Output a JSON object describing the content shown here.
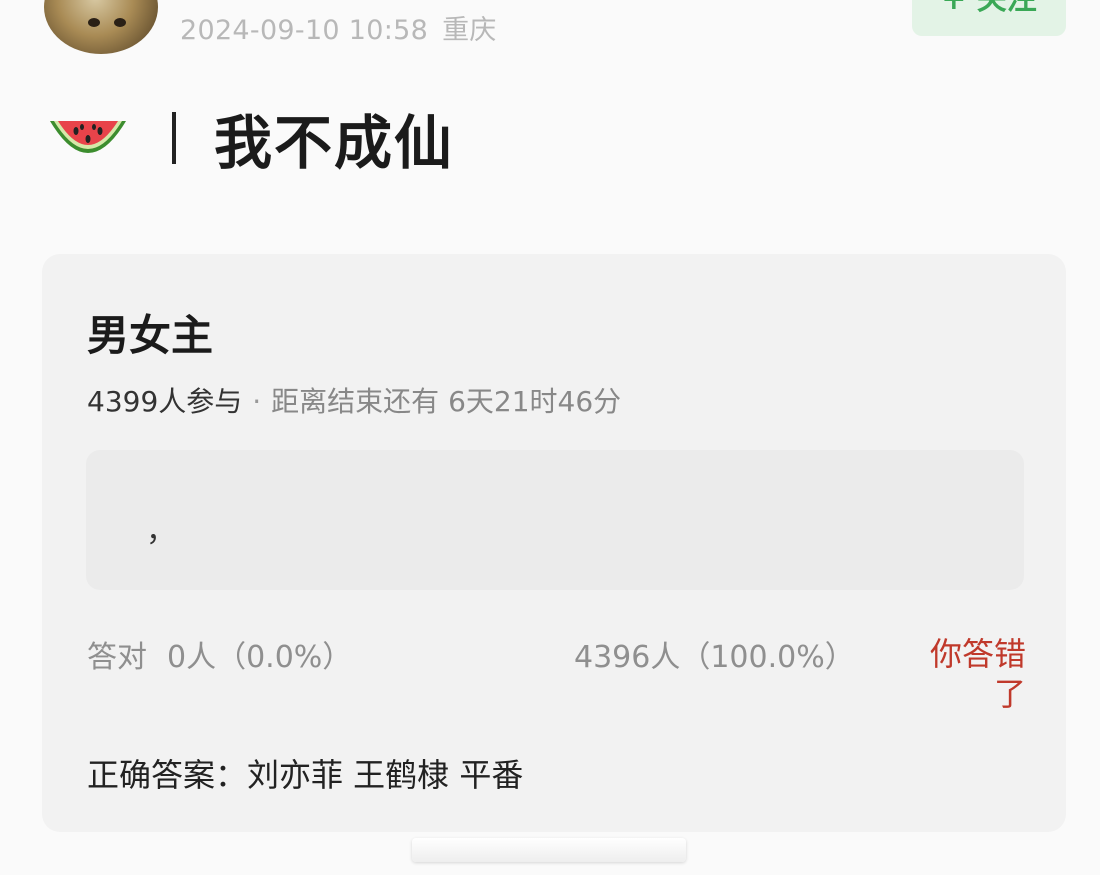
{
  "header": {
    "timestamp": "2024-09-10 10:58",
    "location": "重庆",
    "follow_label": "+ 关注"
  },
  "topic": {
    "icon": "watermelon-icon",
    "title": "我不成仙"
  },
  "quiz": {
    "title": "男女主",
    "participants": "4399人参与",
    "countdown": "距离结束还有 6天21时46分",
    "answer_input": "，",
    "correct_label": "答对",
    "correct_stat": "0人（0.0%）",
    "wrong_stat": "4396人（100.0%）",
    "result_tag": "你答错了",
    "correct_answer": "正确答案：刘亦菲 王鹤棣 平番"
  },
  "colors": {
    "accent_green": "#3aa856",
    "wrong_red": "#c0392b"
  }
}
